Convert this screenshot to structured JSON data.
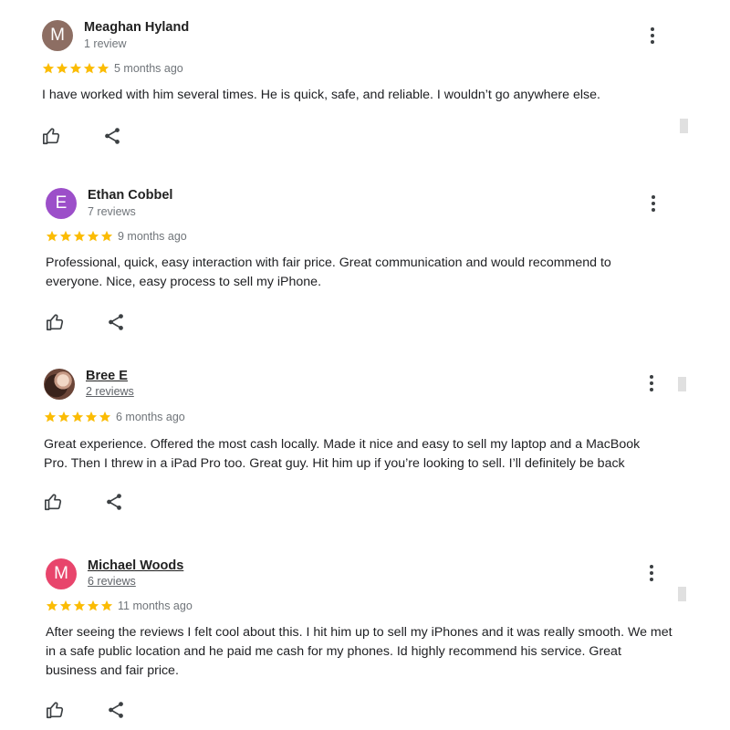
{
  "colors": {
    "star": "#fbbc04",
    "meaghan_avatar": "#8d6e63",
    "ethan_avatar": "#9c4fc9",
    "michael_avatar": "#e8456c"
  },
  "reviews": [
    {
      "initial": "M",
      "name": "Meaghan Hyland",
      "count": "1 review",
      "rating": 5,
      "ago": "5 months ago",
      "text": "I have worked with him several times. He is quick, safe, and reliable. I wouldn’t go anywhere else."
    },
    {
      "initial": "E",
      "name": "Ethan Cobbel",
      "count": "7 reviews",
      "rating": 5,
      "ago": "9 months ago",
      "text": "Professional, quick, easy interaction with fair price. Great communication and would recommend to everyone. Nice, easy process to sell my iPhone."
    },
    {
      "name": "Bree E",
      "count": "2 reviews",
      "rating": 5,
      "ago": "6 months ago",
      "text": "Great experience. Offered the most cash locally. Made it nice and easy to sell my laptop and a MacBook Pro. Then I threw in a iPad Pro too. Great guy. Hit him up if you’re looking to sell. I’ll definitely be back"
    },
    {
      "initial": "M",
      "name": "Michael Woods",
      "count": "6 reviews",
      "rating": 5,
      "ago": "11 months ago",
      "text": "After seeing the reviews I felt cool about this. I hit him up to sell my iPhones and it was really smooth. We met in a safe public location and he paid me cash for my phones. Id highly recommend his service. Great business and fair price."
    }
  ]
}
